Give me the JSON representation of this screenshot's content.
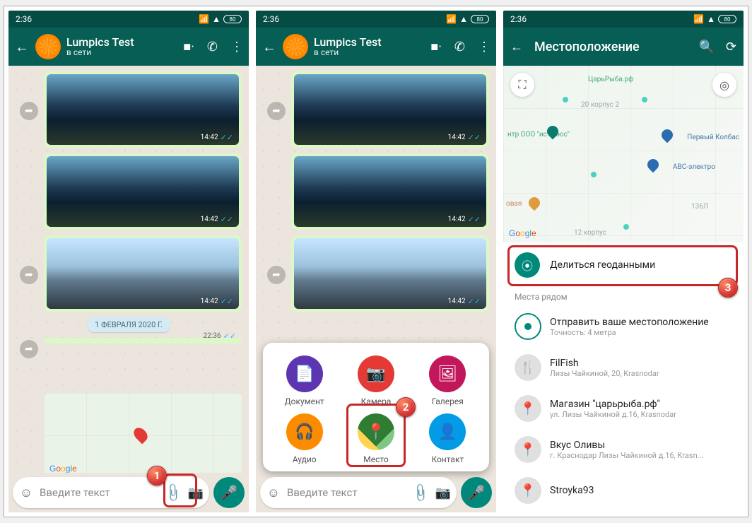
{
  "status": {
    "time": "2:36",
    "battery": "80"
  },
  "chat": {
    "title": "Lumpics Test",
    "subtitle": "в сети"
  },
  "messages": {
    "t1": "14:42",
    "t2": "14:42",
    "t3": "14:42",
    "datepill": "1 ФЕВРАЛЯ 2020 Г.",
    "map_time": "22:36"
  },
  "input": {
    "placeholder": "Введите текст"
  },
  "attach": {
    "doc": "Документ",
    "cam": "Камера",
    "gal": "Галерея",
    "aud": "Аудио",
    "loc": "Место",
    "con": "Контакт"
  },
  "loc": {
    "title": "Местоположение",
    "share": "Делиться геоданными",
    "nearby_header": "Места рядом",
    "send": {
      "t": "Отправить ваше местоположение",
      "s": "Точность: 4 метра"
    },
    "places": [
      {
        "t": "FilFish",
        "s": "Лизы Чайкиной, 20, Krasnodar"
      },
      {
        "t": "Магазин \"царьрыба.рф\"",
        "s": "ул. Лизы Чайкиной д.16, Krasnodar"
      },
      {
        "t": "Вкус Оливы",
        "s": "г. Краснодар Лизы Чайкиной д.16, Krasn..."
      },
      {
        "t": "Stroyka93",
        "s": ""
      }
    ],
    "map_labels": {
      "fish": "ЦарьРыба.рф",
      "korpus": "20 корпус 2",
      "center": "нтр ООО \"ис Плюс\"",
      "kolbas": "Первый Колбас",
      "abc": "АВС-электро",
      "ovaya": "овая",
      "num": "136Л",
      "street": "12 корпус"
    }
  },
  "badges": {
    "b1": "1",
    "b2": "2",
    "b3": "3"
  }
}
